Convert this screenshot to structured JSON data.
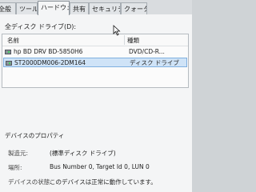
{
  "tabs": [
    {
      "label": "全般"
    },
    {
      "label": "ツール"
    },
    {
      "label": "ハードウェア"
    },
    {
      "label": "共有"
    },
    {
      "label": "セキュリティ"
    },
    {
      "label": "クォータ"
    }
  ],
  "all_disks_label": "全ディスク ドライブ(D):",
  "list": {
    "col_name": "名前",
    "col_type": "種類",
    "rows": [
      {
        "name": "hp BD DRV BD-5850H6",
        "type": "DVD/CD-R..."
      },
      {
        "name": "ST2000DM006-2DM164",
        "type": "ディスク ドライブ"
      }
    ]
  },
  "props": {
    "title": "デバイスのプロパティ",
    "items": [
      {
        "key": "製造元:",
        "value": "(標準ディスク ドライブ)"
      },
      {
        "key": "場所:",
        "value": "Bus Number 0, Target Id 0, LUN 0"
      },
      {
        "key": "デバイスの状態:",
        "value": "このデバイスは正常に動作しています。"
      }
    ]
  }
}
